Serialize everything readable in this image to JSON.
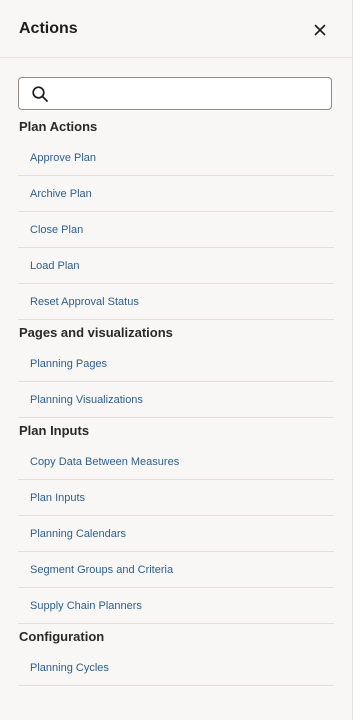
{
  "header": {
    "title": "Actions",
    "close_icon": "close-icon"
  },
  "search": {
    "value": "",
    "placeholder": "",
    "icon": "search-icon"
  },
  "sections": [
    {
      "title": "Plan Actions",
      "items": [
        "Approve Plan",
        "Archive Plan",
        "Close Plan",
        "Load Plan",
        "Reset Approval Status"
      ]
    },
    {
      "title": "Pages and visualizations",
      "items": [
        "Planning Pages",
        "Planning Visualizations"
      ]
    },
    {
      "title": "Plan Inputs",
      "items": [
        "Copy Data Between Measures",
        "Plan Inputs",
        "Planning Calendars",
        "Segment Groups and Criteria",
        "Supply Chain Planners"
      ]
    },
    {
      "title": "Configuration",
      "items": [
        "Planning Cycles"
      ]
    }
  ],
  "colors": {
    "panel_background": "#f8f7f5",
    "link": "#2e5f8a",
    "heading": "#2b2926",
    "divider": "#e2dfda"
  }
}
